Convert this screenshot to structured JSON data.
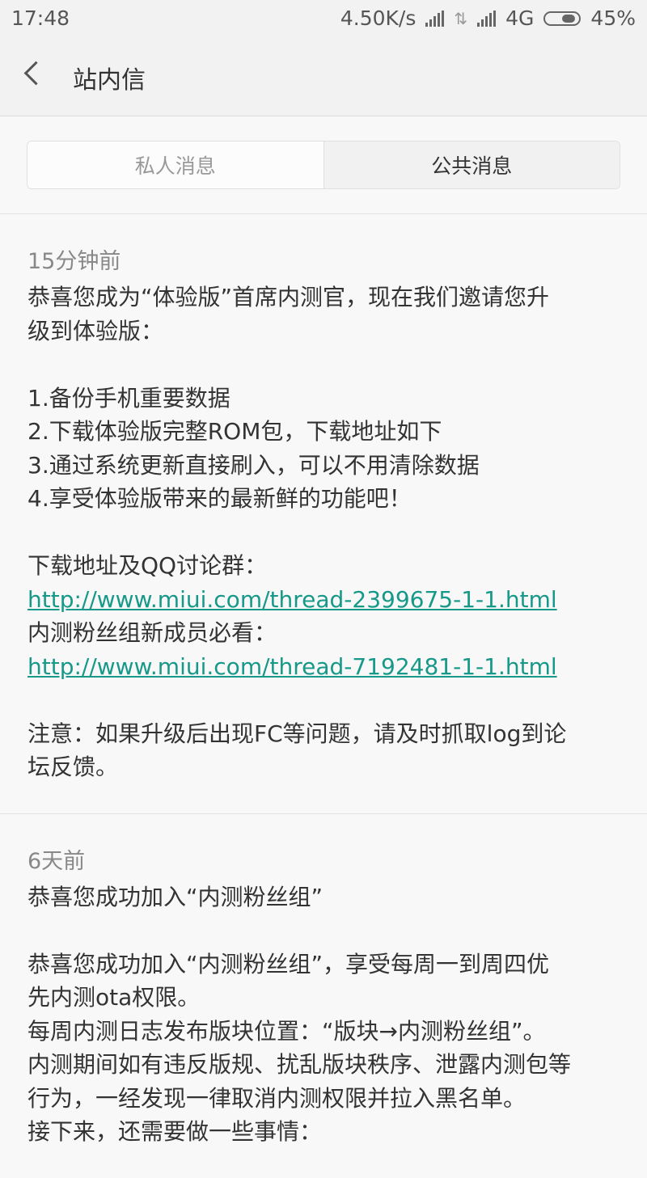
{
  "status_bar": {
    "time": "17:48",
    "speed": "4.50K/s",
    "network": "4G",
    "battery": "45%"
  },
  "header": {
    "title": "站内信"
  },
  "tabs": [
    {
      "label": "私人消息",
      "active": false
    },
    {
      "label": "公共消息",
      "active": true
    }
  ],
  "messages": [
    {
      "time": "15分钟前",
      "lines": [
        "恭喜您成为“体验版”首席内测官，现在我们邀请您升",
        "级到体验版：",
        "",
        "1.备份手机重要数据",
        "2.下载体验版完整ROM包，下载地址如下",
        "3.通过系统更新直接刷入，可以不用清除数据",
        "4.享受体验版带来的最新鲜的功能吧！",
        "",
        "下载地址及QQ讨论群：",
        "http://www.miui.com/thread-2399675-1-1.html",
        "内测粉丝组新成员必看：",
        "http://www.miui.com/thread-7192481-1-1.html",
        "",
        "注意：如果升级后出现FC等问题，请及时抓取log到论",
        "坛反馈。"
      ]
    },
    {
      "time": "6天前",
      "lines": [
        "恭喜您成功加入“内测粉丝组”",
        "",
        "恭喜您成功加入“内测粉丝组”，享受每周一到周四优",
        "先内测ota权限。",
        "每周内测日志发布版块位置：“版块→内测粉丝组”。",
        "内测期间如有违反版规、扰乱版块秩序、泄露内测包等",
        "行为，一经发现一律取消内测权限并拉入黑名单。",
        "接下来，还需要做一些事情："
      ]
    }
  ],
  "colors": {
    "link": "#17998a",
    "header_bg": "#f2f2f2",
    "page_bg": "#f8f8f8"
  }
}
